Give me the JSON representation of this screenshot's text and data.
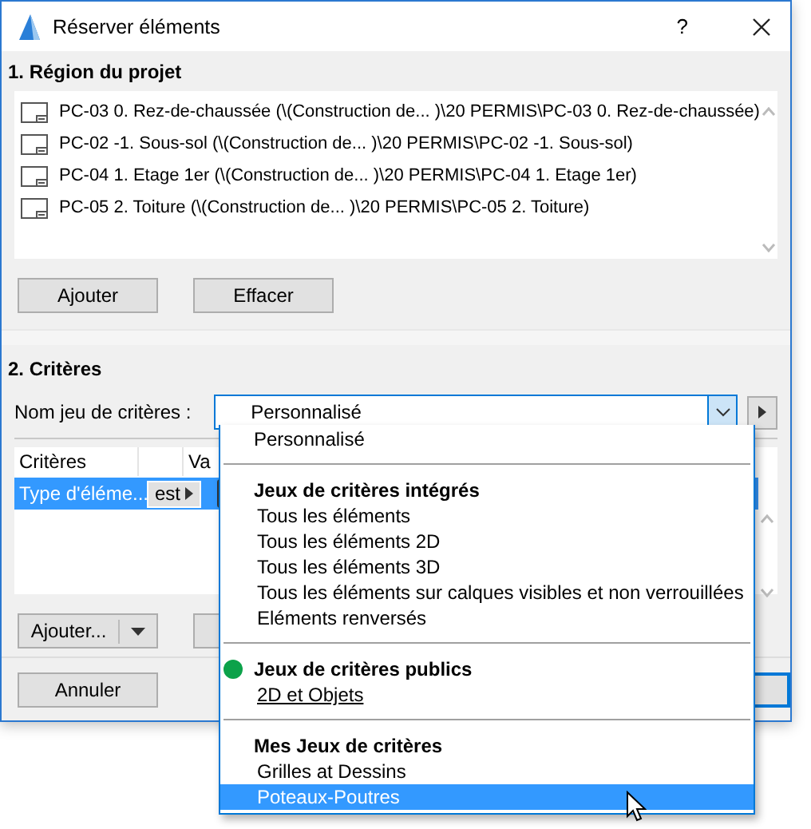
{
  "window": {
    "title": "Réserver éléments",
    "help": "?"
  },
  "project_region": {
    "heading": "1. Région du projet",
    "items": [
      {
        "label": "PC-03 0. Rez-de-chaussée (\\(Construction de... )\\20 PERMIS\\PC-03 0. Rez-de-chaussée)"
      },
      {
        "label": "PC-02 -1. Sous-sol (\\(Construction de... )\\20 PERMIS\\PC-02 -1. Sous-sol)"
      },
      {
        "label": "PC-04 1. Etage 1er (\\(Construction de... )\\20 PERMIS\\PC-04 1. Etage 1er)"
      },
      {
        "label": "PC-05 2. Toiture (\\(Construction de... )\\20 PERMIS\\PC-05 2. Toiture)"
      }
    ],
    "buttons": [
      "Ajouter",
      "Effacer"
    ]
  },
  "criteria": {
    "heading": "2. Critères",
    "set_label": "Nom jeu de critères :",
    "set_value": "Personnalisé",
    "table": {
      "columns": [
        "Critères",
        "Va"
      ],
      "rows": [
        {
          "criterion": "Type d'éléme...",
          "operator": "est",
          "selected": true
        }
      ]
    },
    "add_button": "Ajouter..."
  },
  "footer": {
    "cancel": "Annuler"
  },
  "dropdown": {
    "groups": [
      {
        "options": [
          {
            "label": "Personnalisé",
            "selected": false,
            "underlined": false
          }
        ]
      },
      {
        "heading": "Jeux de critères intégrés",
        "options": [
          {
            "label": "Tous les éléments",
            "selected": false,
            "underlined": false
          },
          {
            "label": "Tous les éléments 2D",
            "selected": false,
            "underlined": false
          },
          {
            "label": "Tous les éléments 3D",
            "selected": false,
            "underlined": false
          },
          {
            "label": "Tous les éléments sur calques visibles et non verrouillées",
            "selected": false,
            "underlined": false
          },
          {
            "label": "Eléments renversés",
            "selected": false,
            "underlined": false
          }
        ]
      },
      {
        "heading": "Jeux de critères publics",
        "color": "#0ca24a",
        "options": [
          {
            "label": "2D et Objets",
            "selected": false,
            "underlined": true
          }
        ]
      },
      {
        "heading": "Mes Jeux de critères",
        "options": [
          {
            "label": "Grilles at Dessins",
            "selected": false,
            "underlined": false
          },
          {
            "label": "Poteaux-Poutres",
            "selected": true,
            "underlined": false
          }
        ]
      }
    ]
  }
}
